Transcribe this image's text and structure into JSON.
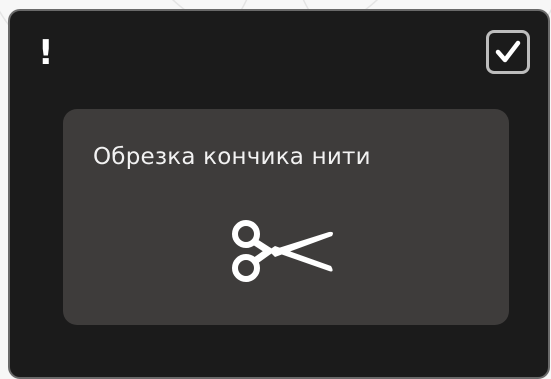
{
  "dialog": {
    "alert_symbol": "!",
    "confirm_icon": "checkmark-icon",
    "message": "Обрезка кончика нити",
    "message_icon": "scissors-icon"
  },
  "colors": {
    "dialog_background": "#1b1b1b",
    "panel_background": "#3e3c3b",
    "text": "#f2f2f2",
    "button_border": "#bdbdbd"
  }
}
